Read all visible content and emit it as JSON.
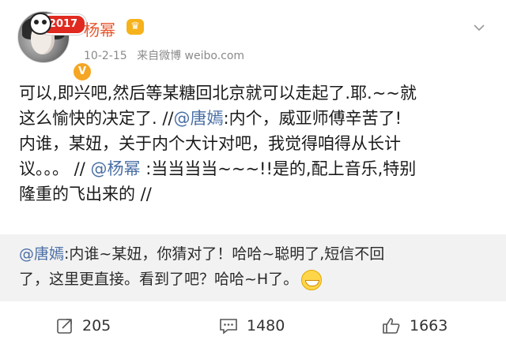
{
  "header": {
    "badge": "2017",
    "name": "杨幂",
    "crown_icon": "crown-icon",
    "date": "10-2-15",
    "source": "来自微博 weibo.com"
  },
  "post": {
    "line1": "可以,即兴吧,然后等某糖回北京就可以走起了.耶.~~就",
    "line2a": "这么愉快的决定了. //",
    "mention1": "@唐嫣",
    "line2b": ":内个，威亚师傅辛苦了!",
    "line3": "内谁，某妞，关于内个大计对吧，我觉得咱得从长计",
    "line4a": "议。。。 // ",
    "mention2": "@杨幂",
    "line4b": " :当当当当~~~!!是的,配上音乐,特别",
    "line5": "隆重的飞出来的 //"
  },
  "repost": {
    "mention": "@唐嫣",
    "text1": ":内谁~某妞，你猜对了！哈哈~聪明了,短信不回",
    "text2": "了，这里更直接。看到了吧？哈哈~H了。"
  },
  "actions": {
    "repost_count": "205",
    "comment_count": "1480",
    "like_count": "1663"
  },
  "colors": {
    "accent_name": "#e8542b",
    "mention": "#4a6fa5",
    "repost_bg": "#f2f2f2"
  }
}
